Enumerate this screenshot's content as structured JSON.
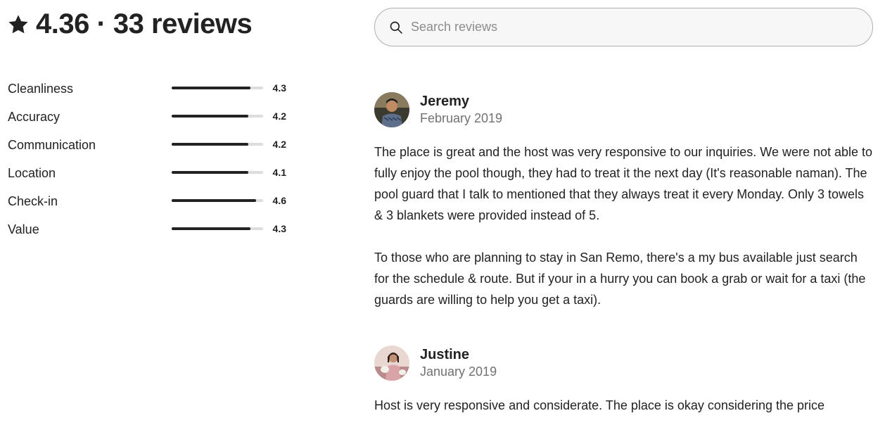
{
  "summary": {
    "title": "4.36 · 33 reviews",
    "icon": "star-icon"
  },
  "ratings": [
    {
      "label": "Cleanliness",
      "value": "4.3",
      "fraction": 0.86
    },
    {
      "label": "Accuracy",
      "value": "4.2",
      "fraction": 0.84
    },
    {
      "label": "Communication",
      "value": "4.2",
      "fraction": 0.84
    },
    {
      "label": "Location",
      "value": "4.1",
      "fraction": 0.84
    },
    {
      "label": "Check-in",
      "value": "4.6",
      "fraction": 0.92
    },
    {
      "label": "Value",
      "value": "4.3",
      "fraction": 0.86
    }
  ],
  "search": {
    "placeholder": "Search reviews",
    "value": ""
  },
  "reviews": [
    {
      "name": "Jeremy",
      "date": "February 2019",
      "paragraphs": [
        "The place is great and the host was very responsive to our inquiries. We were not able to fully enjoy the pool though, they had to treat it the next day (It's reasonable naman). The pool guard that I talk to mentioned that they always treat it every Monday. Only 3 towels & 3 blankets were provided instead of 5.",
        "To those who are planning to stay in San Remo, there's a my bus available just search for the schedule & route. But if your in a hurry you can book a grab or wait for a taxi (the guards are willing to help you get a taxi)."
      ]
    },
    {
      "name": "Justine",
      "date": "January 2019",
      "paragraphs": [
        "Host is very responsive and considerate. The place is okay considering the price"
      ]
    }
  ],
  "colors": {
    "text": "#222222",
    "muted": "#717171",
    "bar_track": "#dddddd",
    "bar_fill": "#222222"
  }
}
